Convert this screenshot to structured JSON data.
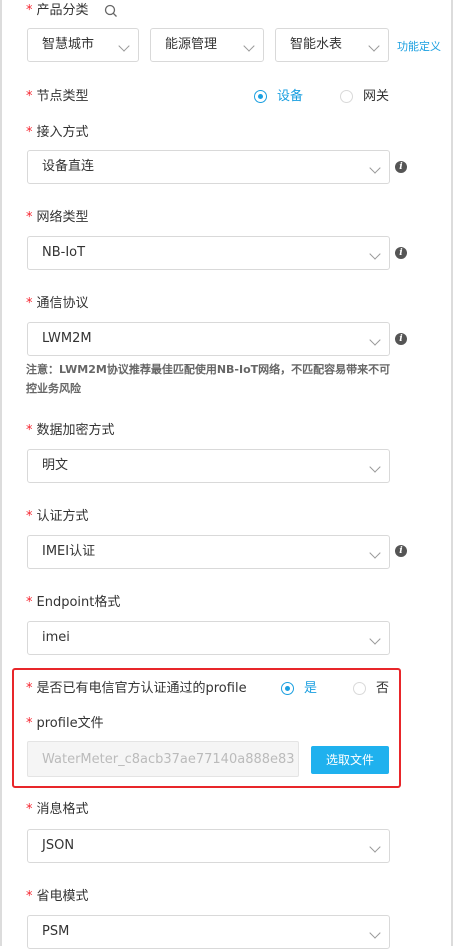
{
  "product_category": {
    "label": "产品分类",
    "search_icon": "search-icon",
    "selects": [
      "智慧城市",
      "能源管理",
      "智能水表"
    ],
    "link": "功能定义"
  },
  "node_type": {
    "label": "节点类型",
    "options": [
      {
        "label": "设备",
        "selected": true
      },
      {
        "label": "网关",
        "selected": false
      }
    ]
  },
  "access_method": {
    "label": "接入方式",
    "value": "设备直连",
    "info_icon": "info-icon"
  },
  "network_type": {
    "label": "网络类型",
    "value": "NB-IoT",
    "info_icon": "info-icon"
  },
  "protocol": {
    "label": "通信协议",
    "value": "LWM2M",
    "info_icon": "info-icon",
    "note": "注意：LWM2M协议推荐最佳匹配使用NB-IoT网络，不匹配容易带来不可控业务风险"
  },
  "encryption": {
    "label": "数据加密方式",
    "value": "明文"
  },
  "auth": {
    "label": "认证方式",
    "value": "IMEI认证",
    "info_icon": "info-icon"
  },
  "endpoint": {
    "label": "Endpoint格式",
    "value": "imei"
  },
  "profile_certified": {
    "label": "是否已有电信官方认证通过的profile",
    "options": [
      {
        "label": "是",
        "selected": true
      },
      {
        "label": "否",
        "selected": false
      }
    ]
  },
  "profile_file": {
    "label": "profile文件",
    "value": "WaterMeter_c8acb37ae77140a888e83",
    "button": "选取文件"
  },
  "message_format": {
    "label": "消息格式",
    "value": "JSON"
  },
  "power_mode": {
    "label": "省电模式",
    "value": "PSM"
  },
  "colors": {
    "accent": "#1a9fe0",
    "required": "#f5222d",
    "highlight": "#e8262a",
    "button": "#1fb1ee"
  }
}
